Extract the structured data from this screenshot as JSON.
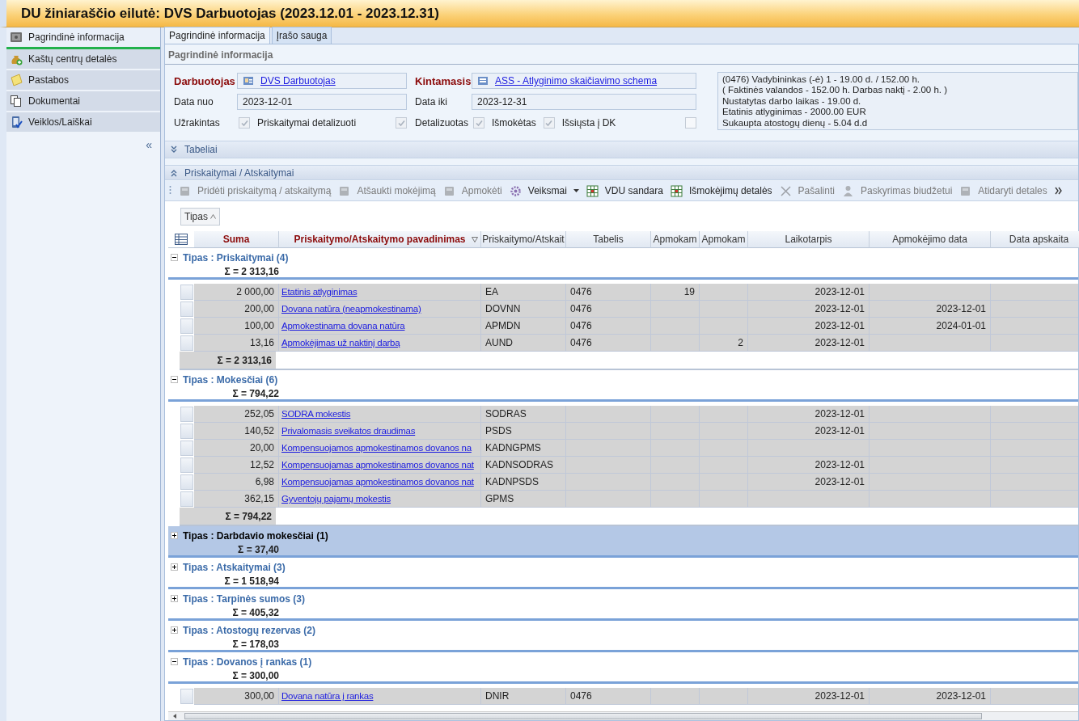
{
  "window": {
    "title": "DU žiniaraščio eilutė: DVS Darbuotojas (2023.12.01 - 2023.12.31)"
  },
  "sidebar": {
    "items": [
      {
        "label": "Pagrindinė informacija",
        "selected": true
      },
      {
        "label": "Kaštų centrų detalės",
        "selected": false
      },
      {
        "label": "Pastabos",
        "selected": false
      },
      {
        "label": "Dokumentai",
        "selected": false
      },
      {
        "label": "Veiklos/Laiškai",
        "selected": false
      }
    ],
    "collapse": "«"
  },
  "tabs": [
    {
      "label": "Pagrindinė informacija",
      "selected": true
    },
    {
      "label": "Įrašo sauga",
      "selected": false
    }
  ],
  "section_title": "Pagrindinė informacija",
  "form": {
    "employee": {
      "label": "Darbuotojas",
      "value": "DVS Darbuotojas"
    },
    "variable": {
      "label": "Kintamasis",
      "value": "ASS - Atlyginimo skaičiavimo schema"
    },
    "date_from": {
      "label": "Data nuo",
      "value": "2023-12-01"
    },
    "date_to": {
      "label": "Data iki",
      "value": "2023-12-31"
    },
    "checkboxes": [
      {
        "label": "Užrakintas",
        "checked": true
      },
      {
        "label": "Priskaitymai detalizuoti",
        "checked": true
      },
      {
        "label": "Detalizuotas",
        "checked": true
      },
      {
        "label": "Išmokėtas",
        "checked": true
      },
      {
        "label": "Išsiųsta į DK",
        "checked": false
      }
    ],
    "info_lines": [
      "(0476) Vadybininkas (-ė) 1 - 19.00 d. / 152.00 h.",
      "( Faktinės valandos - 152.00 h. Darbas naktį - 2.00 h. )",
      "Nustatytas darbo laikas - 19.00 d.",
      "Etatinis atlyginimas - 2000.00 EUR",
      "Sukaupta atostogų dienų - 5.04 d.d"
    ]
  },
  "panels": [
    {
      "title": "Tabeliai",
      "expanded": false
    },
    {
      "title": "Priskaitymai / Atskaitymai",
      "expanded": true
    }
  ],
  "toolbar": [
    {
      "label": "Pridėti priskaitymą / atskaitymą",
      "disabled": true,
      "has_menu": false
    },
    {
      "label": "Atšaukti mokėjimą",
      "disabled": true,
      "has_menu": false
    },
    {
      "label": "Apmokėti",
      "disabled": true,
      "has_menu": false
    },
    {
      "label": "Veiksmai",
      "disabled": false,
      "has_menu": true
    },
    {
      "label": "VDU sandara",
      "disabled": false,
      "has_menu": false
    },
    {
      "label": "Išmokėjimų detalės",
      "disabled": false,
      "has_menu": false
    },
    {
      "label": "Pašalinti",
      "disabled": true,
      "has_menu": false
    },
    {
      "label": "Paskyrimas biudžetui",
      "disabled": true,
      "has_menu": false
    },
    {
      "label": "Atidaryti detales",
      "disabled": true,
      "has_menu": false
    }
  ],
  "group_by": "Tipas",
  "columns": [
    {
      "label": "Suma",
      "highlighted": true
    },
    {
      "label": "Priskaitymo/Atskaitymo pavadinimas",
      "highlighted": true
    },
    {
      "label": "Priskaitymo/Atskait",
      "highlighted": false
    },
    {
      "label": "Tabelis",
      "highlighted": false
    },
    {
      "label": "Apmokam",
      "highlighted": false
    },
    {
      "label": "Apmokam",
      "highlighted": false
    },
    {
      "label": "Laikotarpis",
      "highlighted": false
    },
    {
      "label": "Apmokėjimo data",
      "highlighted": false
    },
    {
      "label": "Data apskaita",
      "highlighted": false
    }
  ],
  "groups": [
    {
      "title": "Tipas : Priskaitymai (4)",
      "sum": "Σ = 2 313,16",
      "expanded": true,
      "selected": false,
      "footer_sum": "Σ = 2 313,16",
      "rows": [
        {
          "amount": "2 000,00",
          "name": "Etatinis atlyginimas",
          "code": "EA",
          "timesheet": "0476",
          "apmokam_1": "19",
          "period": "2023-12-01"
        },
        {
          "amount": "200,00",
          "name": "Dovana natūra (neapmokestinama)",
          "code": "DOVNN",
          "timesheet": "0476",
          "period": "2023-12-01",
          "payment_date": "2023-12-01"
        },
        {
          "amount": "100,00",
          "name": "Apmokestinama dovana natūra",
          "code": "APMDN",
          "timesheet": "0476",
          "period": "2023-12-01",
          "payment_date": "2024-01-01"
        },
        {
          "amount": "13,16",
          "name": "Apmokėjimas už naktinį darbą",
          "code": "AUND",
          "timesheet": "0476",
          "apmokam_2": "2",
          "period": "2023-12-01"
        }
      ]
    },
    {
      "title": "Tipas : Mokesčiai (6)",
      "sum": "Σ = 794,22",
      "expanded": true,
      "selected": false,
      "footer_sum": "Σ = 794,22",
      "rows": [
        {
          "amount": "252,05",
          "name": "SODRA mokestis",
          "code": "SODRAS",
          "period": "2023-12-01"
        },
        {
          "amount": "140,52",
          "name": "Privalomasis sveikatos draudimas",
          "code": "PSDS",
          "period": "2023-12-01"
        },
        {
          "amount": "20,00",
          "name": "Kompensuojamos apmokestinamos dovanos na",
          "code": "KADNGPMS"
        },
        {
          "amount": "12,52",
          "name": "Kompensuojamas apmokestinamos dovanos nat",
          "code": "KADNSODRAS",
          "period": "2023-12-01"
        },
        {
          "amount": "6,98",
          "name": "Kompensuojamas apmokestinamos dovanos nat",
          "code": "KADNPSDS",
          "period": "2023-12-01"
        },
        {
          "amount": "362,15",
          "name": "Gyventojų pajamų mokestis",
          "code": "GPMS"
        }
      ]
    },
    {
      "title": "Tipas : Darbdavio mokesčiai (1)",
      "sum": "Σ = 37,40",
      "expanded": false,
      "selected": true
    },
    {
      "title": "Tipas : Atskaitymai (3)",
      "sum": "Σ = 1 518,94",
      "expanded": false,
      "selected": false
    },
    {
      "title": "Tipas : Tarpinės sumos (3)",
      "sum": "Σ = 405,32",
      "expanded": false,
      "selected": false
    },
    {
      "title": "Tipas : Atostogų rezervas (2)",
      "sum": "Σ = 178,03",
      "expanded": false,
      "selected": false
    },
    {
      "title": "Tipas : Dovanos į rankas (1)",
      "sum": "Σ = 300,00",
      "expanded": true,
      "selected": false,
      "rows": [
        {
          "amount": "300,00",
          "name": "Dovana natūra į rankas",
          "code": "DNIR",
          "timesheet": "0476",
          "period": "2023-12-01",
          "payment_date": "2023-12-01"
        }
      ]
    }
  ]
}
